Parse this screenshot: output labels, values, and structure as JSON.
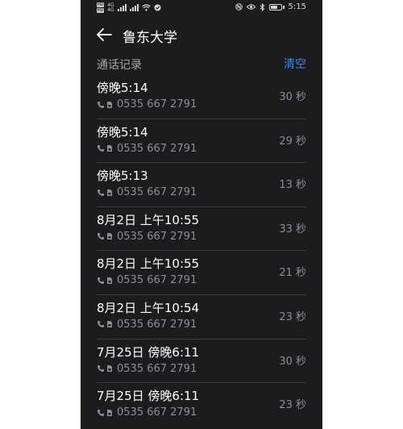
{
  "statusbar": {
    "sim1_label": "HD",
    "sim2_label": "HD",
    "signal_1_label": "4G",
    "signal_2_label": "4G",
    "time": "5:15",
    "battery_label": "■",
    "battery_level": 0.7
  },
  "header": {
    "title": "鲁东大学"
  },
  "section": {
    "label": "通话记录",
    "clear_label": "清空"
  },
  "calls": [
    {
      "when": "傍晚5:14",
      "number": "0535 667 2791",
      "duration": "30 秒"
    },
    {
      "when": "傍晚5:14",
      "number": "0535 667 2791",
      "duration": "29 秒"
    },
    {
      "when": "傍晚5:13",
      "number": "0535 667 2791",
      "duration": "13 秒"
    },
    {
      "when": "8月2日 上午10:55",
      "number": "0535 667 2791",
      "duration": "33 秒"
    },
    {
      "when": "8月2日 上午10:55",
      "number": "0535 667 2791",
      "duration": "21 秒"
    },
    {
      "when": "8月2日 上午10:54",
      "number": "0535 667 2791",
      "duration": "23 秒"
    },
    {
      "when": "7月25日 傍晚6:11",
      "number": "0535 667 2791",
      "duration": "30 秒"
    },
    {
      "when": "7月25日 傍晚6:11",
      "number": "0535 667 2791",
      "duration": "23 秒"
    }
  ],
  "colors": {
    "background": "#1c1c1e",
    "accent": "#2c8df5",
    "secondary_text": "#8e8e93"
  }
}
